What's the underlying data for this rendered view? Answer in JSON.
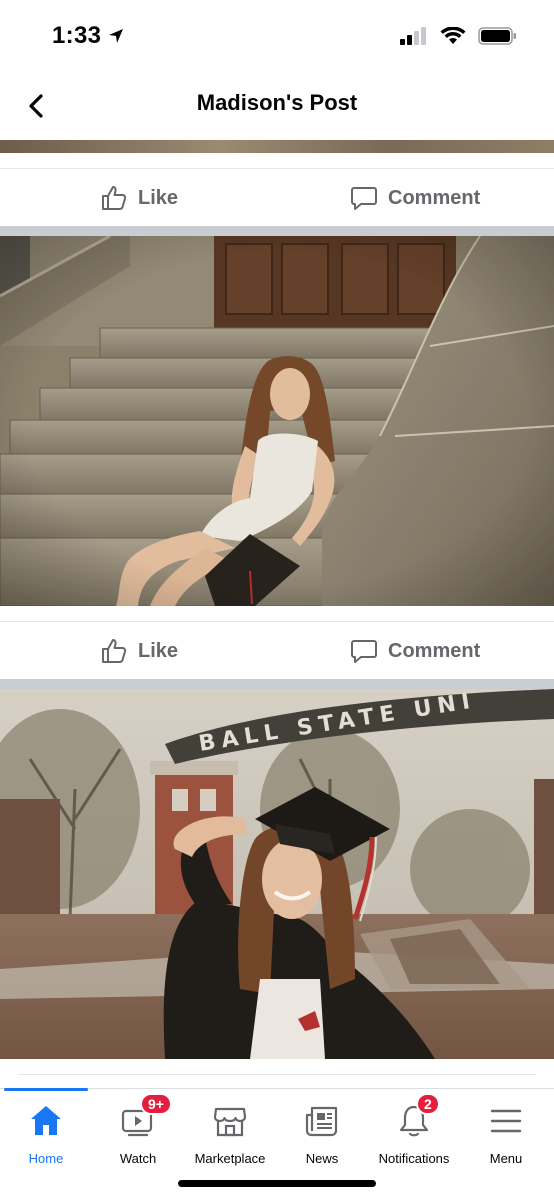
{
  "status_bar": {
    "time": "1:33"
  },
  "header": {
    "title": "Madison's Post"
  },
  "post_actions": {
    "like_label": "Like",
    "comment_label": "Comment"
  },
  "tabbar": {
    "tabs": [
      {
        "label": "Home",
        "icon": "home-icon",
        "active": true
      },
      {
        "label": "Watch",
        "icon": "watch-icon",
        "badge": "9+"
      },
      {
        "label": "Marketplace",
        "icon": "marketplace-icon"
      },
      {
        "label": "News",
        "icon": "news-icon"
      },
      {
        "label": "Notifications",
        "icon": "bell-icon",
        "badge": "2"
      },
      {
        "label": "Menu",
        "icon": "menu-icon"
      }
    ]
  },
  "photo_2": {
    "sign_text": "BALL STATE UNI"
  },
  "colors": {
    "accent": "#1877f2",
    "badge": "#e41e3f",
    "action_text": "#65676b",
    "divider": "#c9ccd1"
  }
}
